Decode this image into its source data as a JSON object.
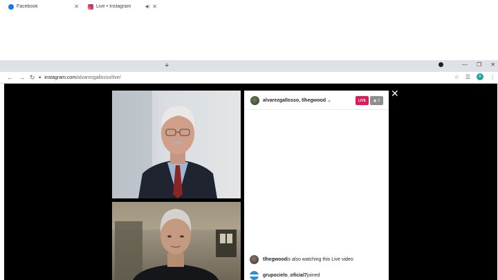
{
  "browser": {
    "tabs": [
      {
        "label": "Facebook",
        "favicon": "facebook-icon",
        "active": false
      },
      {
        "label": "Live • Instagram",
        "favicon": "instagram-icon",
        "active": true
      }
    ],
    "url_host": "instagram.com",
    "url_path": "/alvarezgallosso/live/",
    "profile_initial": "A",
    "accent": "#1aa39a"
  },
  "live": {
    "header_users": "alvarezgallosso, tlhegwood",
    "live_label": "LIVE",
    "viewer_count": "2",
    "live_color": "#e1185c"
  },
  "comments": [
    {
      "user": "tlhegwood",
      "text": " is also watching this Live video"
    },
    {
      "user": "grupocielo_oficial7",
      "text": " joined"
    }
  ]
}
